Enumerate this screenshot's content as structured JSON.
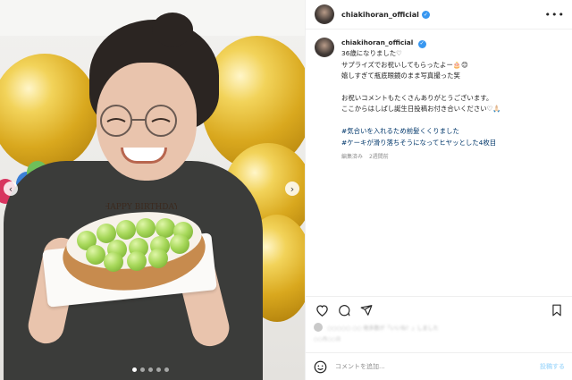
{
  "post": {
    "username": "chiakihoran_official",
    "caption_lines": [
      "36歳になりました♡",
      "サプライズでお祝いしてもらったよー🎂😊",
      "嬉しすぎて瓶底眼鏡のまま写真撮った笑",
      "",
      "お祝いコメントもたくさんありがとうございます。",
      "ここからはしばし誕生日投稿お付き合いください♡🙏🏻",
      "",
      "#気合いを入れるため前髪くくりました",
      "#ケーキが滑り落ちそうになってヒヤッとした4枚目"
    ],
    "edited_label": "編集済み",
    "time_ago": "2週間前",
    "likes_text": "○○○○○ ○○ 他多数が「いいね！」しました",
    "date_text": "○○月○○日",
    "photo_topper_text": "HAPPY BIRTHDAY",
    "carousel": {
      "count": 5,
      "active_index": 0
    }
  },
  "icons": {
    "verified": "verified-badge-icon",
    "more": "more-options-icon",
    "like": "heart-icon",
    "comment": "comment-icon",
    "share": "share-icon",
    "save": "bookmark-icon",
    "emoji": "smiley-icon"
  },
  "comment_bar": {
    "placeholder": "コメントを追加...",
    "post_label": "投稿する"
  },
  "colors": {
    "accent": "#3897f0",
    "link": "#00376b",
    "post_disabled": "#b2dffc",
    "border": "#efefef"
  }
}
